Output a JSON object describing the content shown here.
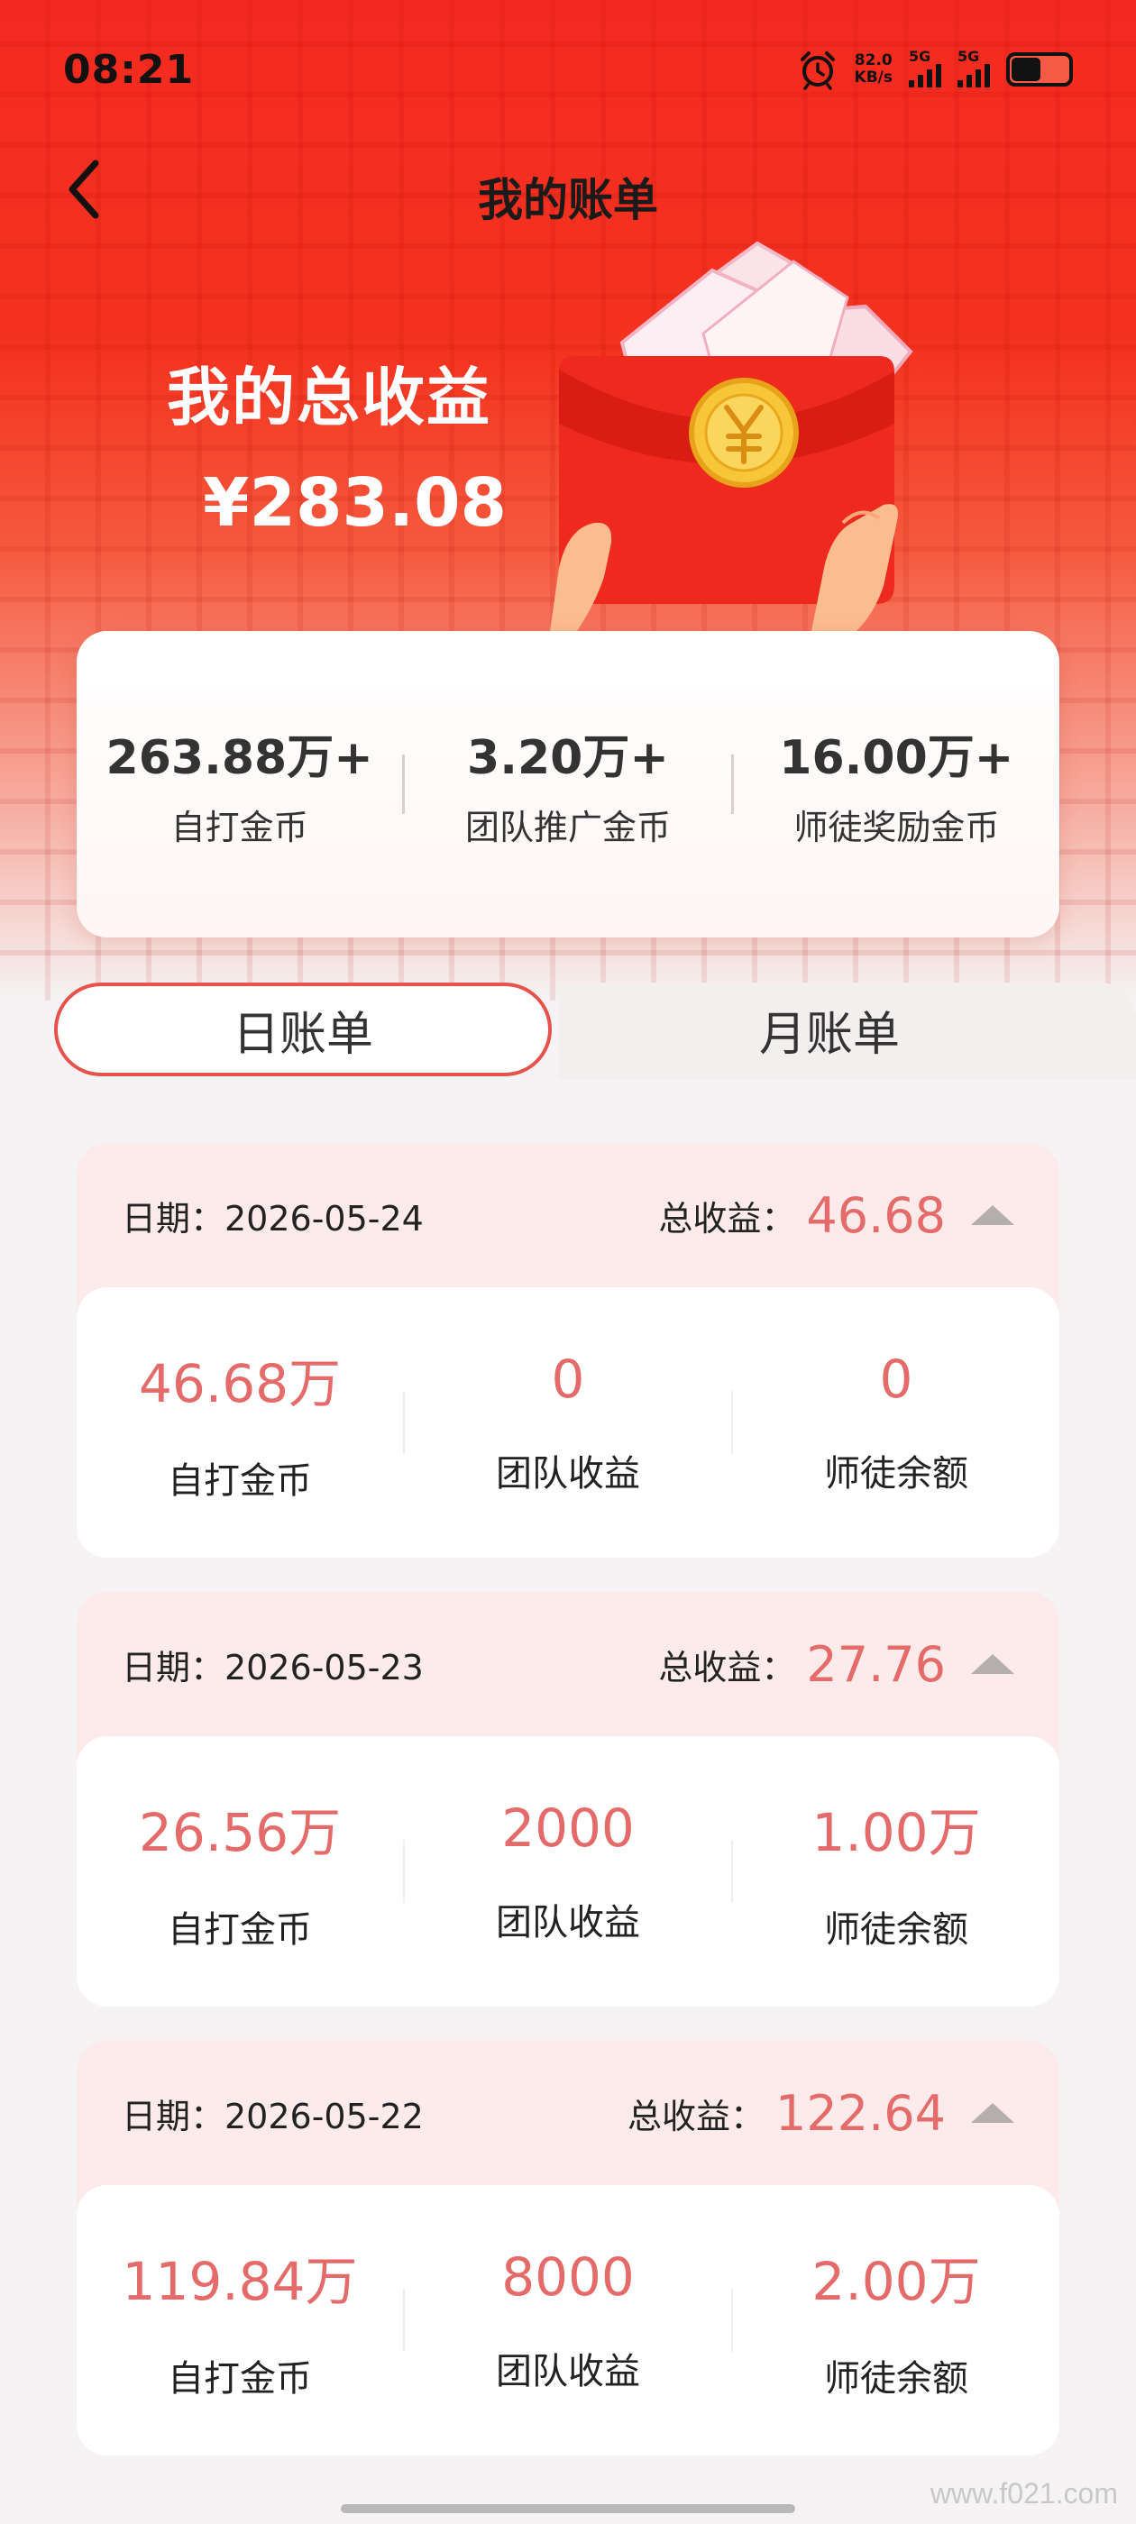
{
  "status_bar": {
    "time": "08:21",
    "net_speed_value": "82.0",
    "net_speed_unit": "KB/s",
    "signal_1": "5G",
    "signal_2": "5G"
  },
  "header": {
    "title": "我的账单"
  },
  "earnings": {
    "label": "我的总收益",
    "amount": "¥283.08"
  },
  "summary": [
    {
      "value": "263.88万+",
      "label": "自打金币"
    },
    {
      "value": "3.20万+",
      "label": "团队推广金币"
    },
    {
      "value": "16.00万+",
      "label": "师徒奖励金币"
    }
  ],
  "tabs": {
    "daily": "日账单",
    "monthly": "月账单",
    "active": "daily"
  },
  "bills": [
    {
      "date_label": "日期：2026-05-24",
      "total_label": "总收益：",
      "total": "46.68",
      "items": [
        {
          "value": "46.68万",
          "label": "自打金币"
        },
        {
          "value": "0",
          "label": "团队收益"
        },
        {
          "value": "0",
          "label": "师徒余额"
        }
      ]
    },
    {
      "date_label": "日期：2026-05-23",
      "total_label": "总收益：",
      "total": "27.76",
      "items": [
        {
          "value": "26.56万",
          "label": "自打金币"
        },
        {
          "value": "2000",
          "label": "团队收益"
        },
        {
          "value": "1.00万",
          "label": "师徒余额"
        }
      ]
    },
    {
      "date_label": "日期：2026-05-22",
      "total_label": "总收益：",
      "total": "122.64",
      "items": [
        {
          "value": "119.84万",
          "label": "自打金币"
        },
        {
          "value": "8000",
          "label": "团队收益"
        },
        {
          "value": "2.00万",
          "label": "师徒余额"
        }
      ]
    }
  ],
  "watermark": "www.f021.com",
  "colors": {
    "brand_red": "#f42a20",
    "value_pink": "#e56a6a",
    "tab_border": "#e8524d"
  }
}
